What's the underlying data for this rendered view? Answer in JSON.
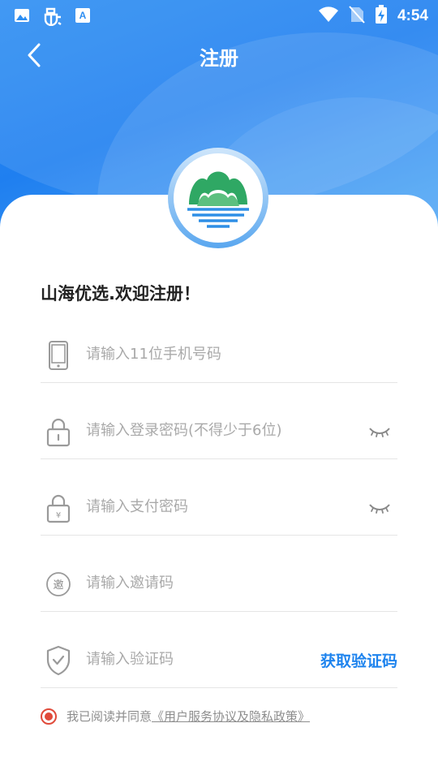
{
  "status_bar": {
    "time": "4:54",
    "left_icons": [
      "image-icon",
      "bug-icon",
      "keyboard-a-icon"
    ],
    "right_icons": [
      "wifi-icon",
      "no-sim-icon",
      "battery-charging-icon"
    ]
  },
  "header": {
    "title": "注册"
  },
  "welcome": "山海优选.欢迎注册！",
  "form": {
    "phone_placeholder": "请输入11位手机号码",
    "login_password_placeholder": "请输入登录密码(不得少于6位)",
    "pay_password_placeholder": "请输入支付密码",
    "invite_placeholder": "请输入邀请码",
    "invite_icon_glyph": "邀",
    "verify_placeholder": "请输入验证码",
    "get_code_label": "获取验证码"
  },
  "agreement": {
    "prefix": "我已阅读并同意",
    "link": "《用户服务协议及隐私政策》",
    "checked": true
  },
  "colors": {
    "primary": "#1f84ee",
    "accent_red": "#e04a3a",
    "placeholder": "#a9a9a9",
    "logo_green": "#2fa864",
    "logo_blue": "#2f8fe6"
  }
}
